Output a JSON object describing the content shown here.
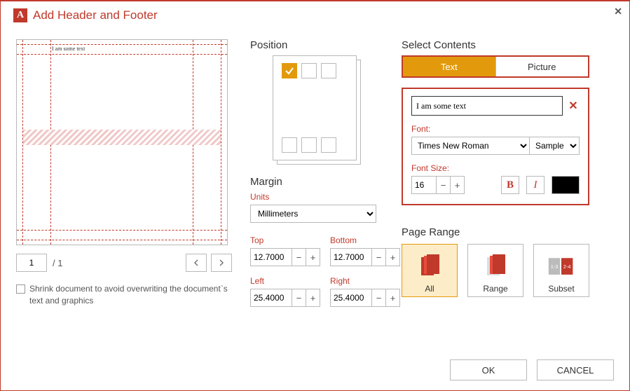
{
  "title": "Add Header and Footer",
  "preview": {
    "sample_text": "I am some text"
  },
  "pager": {
    "current": "1",
    "total": "/ 1"
  },
  "shrink": {
    "label": "Shrink document to avoid overwriting the document`s text and graphics",
    "checked": false
  },
  "position": {
    "heading": "Position",
    "selected": "top-left"
  },
  "margin": {
    "heading": "Margin",
    "units_label": "Units",
    "units_value": "Millimeters",
    "top_label": "Top",
    "bottom_label": "Bottom",
    "left_label": "Left",
    "right_label": "Right",
    "top": "12.7000",
    "bottom": "12.7000",
    "left": "25.4000",
    "right": "25.4000"
  },
  "select_contents": {
    "heading": "Select Contents",
    "tabs": {
      "text": "Text",
      "picture": "Picture",
      "active": "text"
    },
    "text_value": "I am some text",
    "font_label": "Font:",
    "font_name": "Times New Roman",
    "font_sample": "Sample",
    "font_size_label": "Font Size:",
    "font_size": "16",
    "bold_label": "B",
    "italic_label": "I",
    "color": "#000000"
  },
  "page_range": {
    "heading": "Page Range",
    "all": "All",
    "range": "Range",
    "subset": "Subset",
    "selected": "all"
  },
  "footer": {
    "ok": "OK",
    "cancel": "CANCEL"
  }
}
